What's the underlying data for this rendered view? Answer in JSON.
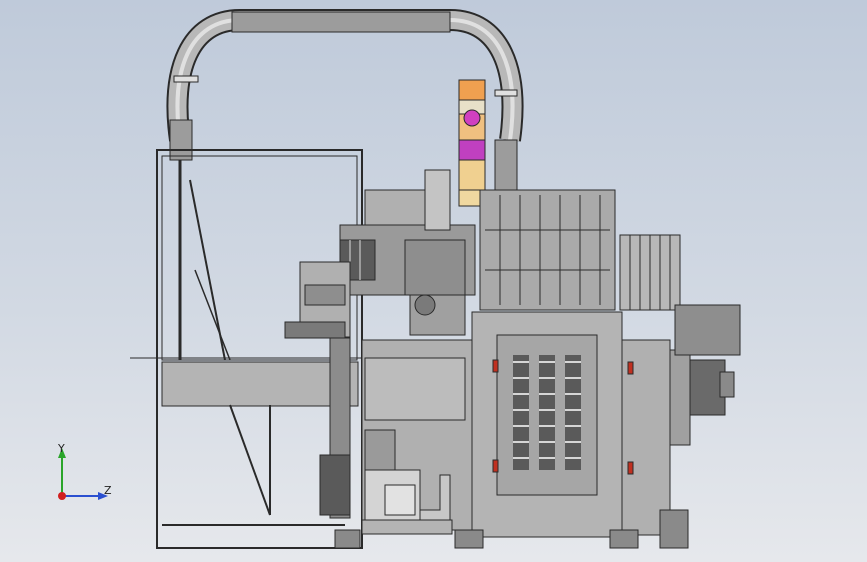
{
  "viewport": {
    "background_top": "#bfcada",
    "background_bottom": "#e6e8ec"
  },
  "triad": {
    "y_label": "Y",
    "z_label": "Z",
    "y_color": "#2aa52a",
    "z_color": "#2a4fd0",
    "origin_color": "#d02020"
  },
  "model": {
    "line_color": "#2a2a2a",
    "body_fill": "#a8a8a8",
    "panel_fill": "#b4b4b4",
    "dark_fill": "#6a6a6a",
    "tower_colors": [
      "#f0a050",
      "#d040c0",
      "#f0c080",
      "#c040c0",
      "#f0d090",
      "#f0d8a0"
    ],
    "accent_red": "#c03020"
  }
}
